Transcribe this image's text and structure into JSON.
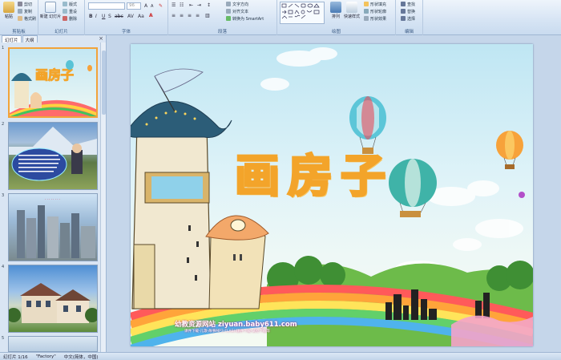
{
  "ribbon": {
    "clipboard": {
      "label": "剪贴板",
      "paste": "粘贴",
      "cut": "剪切",
      "copy": "复制",
      "format_painter": "格式刷"
    },
    "slides": {
      "label": "幻灯片",
      "new_slide": "新建\n幻灯片",
      "layout": "版式",
      "reset": "重设",
      "delete": "删除"
    },
    "font": {
      "label": "字体",
      "size": "96"
    },
    "paragraph": {
      "label": "段落",
      "text_direction": "文字方向",
      "align_text": "对齐文本",
      "smartart": "转换为 SmartArt"
    },
    "drawing": {
      "label": "绘图",
      "arrange": "排列",
      "quick_styles": "快速样式",
      "shape_fill": "形状填充",
      "shape_outline": "形状轮廓",
      "shape_effects": "形状效果"
    },
    "editing": {
      "label": "编辑",
      "find": "查找",
      "replace": "替换",
      "select": "选择"
    }
  },
  "leftpane": {
    "tab_slides": "幻灯片",
    "tab_outline": "大纲",
    "close": "×",
    "thumbs": [
      {
        "num": "1"
      },
      {
        "num": "2"
      },
      {
        "num": "3"
      },
      {
        "num": "4"
      },
      {
        "num": "5"
      }
    ]
  },
  "slide": {
    "title": "画房子",
    "site": "幼教资源网站  ziyuan.baby611.com",
    "subtitle": "课件下载-儿歌-故事MP3-FLASH课件下载-试卷下载等"
  },
  "status": {
    "slide_info": "幻灯片 1/16",
    "theme": "\"Factory\"",
    "language": "中文(简体，中国)"
  },
  "colors": {
    "accent": "#f3a42a",
    "ribbon": "#d6e4f4"
  }
}
